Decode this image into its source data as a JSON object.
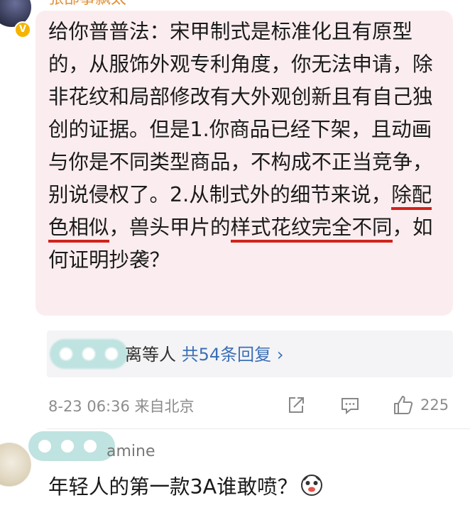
{
  "top_comment": {
    "username": "张部事飘太",
    "verified_badge": "V",
    "text_before_u1": "给你普普法：宋甲制式是标准化且有原型的，从服饰外观专利角度，你无法申请，除非花纹和局部修改有大外观创新且有自己独创的证据。但是1.你商品已经下架，且动画与你是不同类型商品，不构成不正当竞争，别说侵权了。2.从制式外的细节来说，",
    "underline_1": "除配色相似",
    "text_between": "，兽头甲片的",
    "underline_2": "样式花纹完全不同",
    "text_after": "，如何证明抄袭？",
    "underline_color": "#d0231b",
    "bubble_color": "#fbedef"
  },
  "replies_preview": {
    "text_suffix": "离等人",
    "count_label": "共54条回复",
    "chevron": "›",
    "link_color": "#3b6fb6"
  },
  "meta": {
    "timestamp": "8-23 06:36 来自北京",
    "like_count": "225",
    "icons": [
      "share-icon",
      "comment-icon",
      "like-icon"
    ]
  },
  "next_comment": {
    "username_visible": "amine",
    "text": "年轻人的第一款3A谁敢喷？"
  }
}
